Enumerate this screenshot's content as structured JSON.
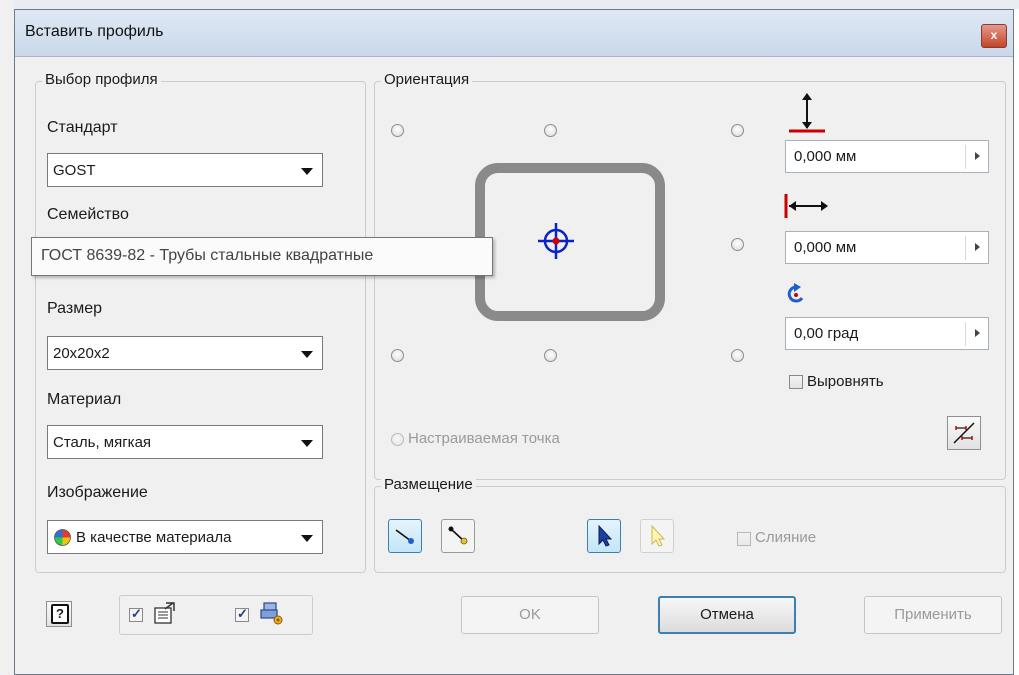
{
  "dialog": {
    "title": "Вставить профиль",
    "close_label": "x"
  },
  "profile_selection": {
    "legend": "Выбор профиля",
    "standard_label": "Стандарт",
    "standard_value": "GOST",
    "family_label": "Семейство",
    "family_tooltip": "ГОСТ 8639-82 - Трубы стальные квадратные",
    "size_label": "Размер",
    "size_value": "20x20x2",
    "material_label": "Материал",
    "material_value": "Сталь, мягкая",
    "appearance_label": "Изображение",
    "appearance_value": "В качестве материала"
  },
  "orientation": {
    "legend": "Ориентация",
    "vertical_offset": "0,000 мм",
    "horizontal_offset": "0,000 мм",
    "angle": "0,00 град",
    "align_label": "Выровнять",
    "custom_point_label": "Настраиваемая точка"
  },
  "placement": {
    "legend": "Размещение",
    "merge_label": "Слияние"
  },
  "footer": {
    "help_icon": "?",
    "ok_label": "OK",
    "cancel_label": "Отмена",
    "apply_label": "Применить"
  },
  "colors": {
    "accent_blue": "#3c7fb1",
    "marker_red": "#cc0000",
    "profile_gray": "#8a8a8a"
  }
}
